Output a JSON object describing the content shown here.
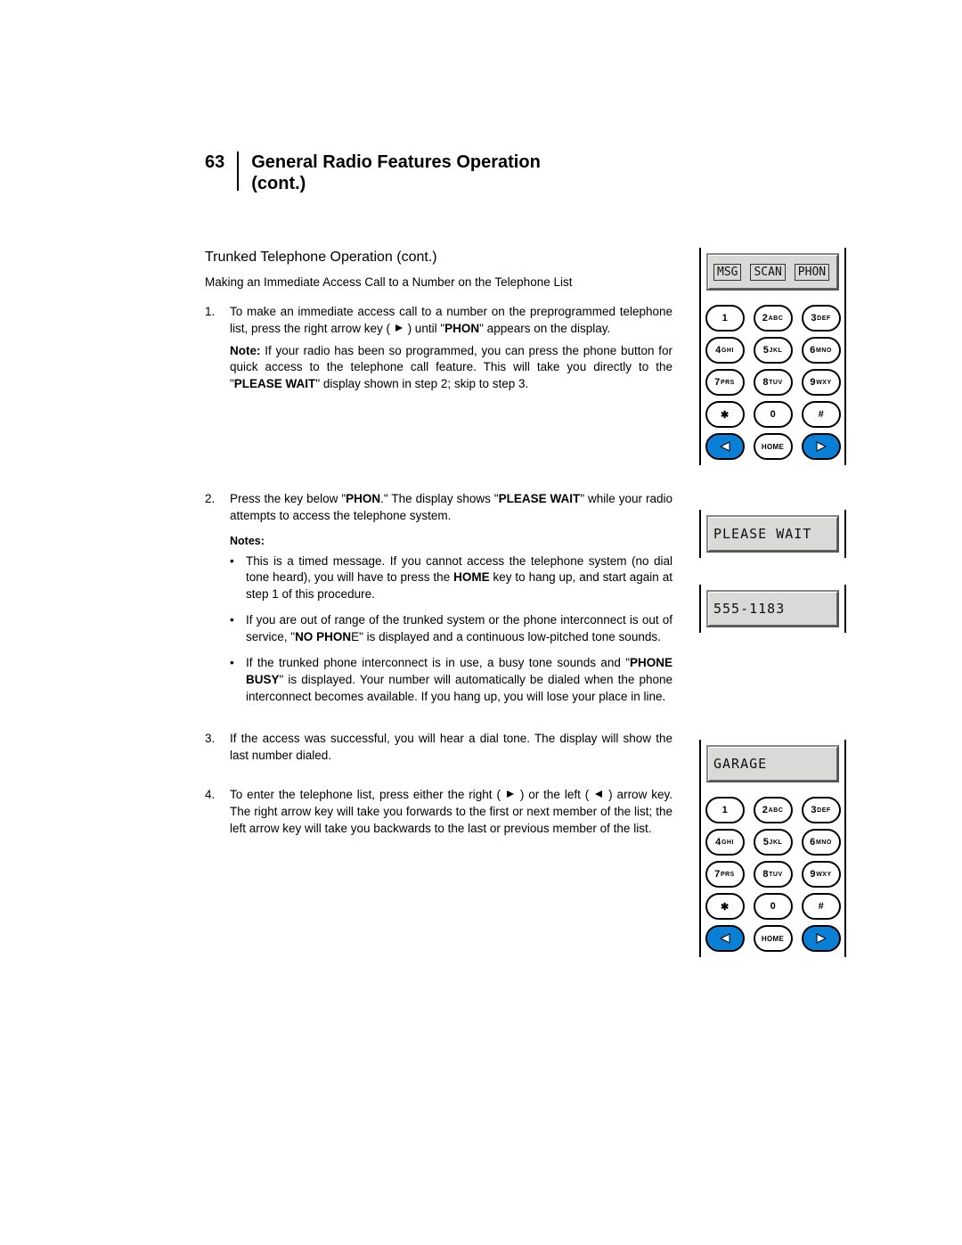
{
  "header": {
    "page_number": "63",
    "title_line1": "General Radio Features Operation",
    "title_line2": "(cont.)"
  },
  "subsection": "Trunked Telephone Operation (cont.)",
  "intro": "Making an Immediate Access Call to a Number on the Telephone List",
  "steps": {
    "s1": {
      "num": "1.",
      "text_before_arrow": "To make an immediate access call to a number on the preprogrammed telephone list, press the right arrow key ( ",
      "text_after_arrow": " ) until \"",
      "bold1": "PHON",
      "text_after_bold": "\" appears on the display.",
      "note_prefix": "Note:",
      "note_body_1": " If your radio has been so programmed, you can press the phone button for quick access to the telephone call feature. This will take you directly to the \"",
      "note_bold": "PLEASE WAIT",
      "note_body_2": "\" display shown in step 2; skip to step 3."
    },
    "s2": {
      "num": "2.",
      "text_1": "Press the key below \"",
      "bold1": "PHON",
      "text_2": ".\" The display shows \"",
      "bold2": "PLEASE WAIT",
      "text_3": "\" while your radio attempts to access the telephone system."
    },
    "notes_label": "Notes:",
    "notes": {
      "n1_a": "This is a timed message. If you cannot access the telephone system (no dial tone heard), you will have to press the ",
      "n1_bold": "HOME",
      "n1_b": " key to hang up, and start again at step 1 of this procedure.",
      "n2_a": "If you are out of range of the trunked system or the phone interconnect is out of service, \"",
      "n2_bold": "NO PHON",
      "n2_b": "E\" is displayed and a continuous low-pitched tone sounds.",
      "n3_a": "If the trunked phone interconnect is in use, a busy tone sounds and \"",
      "n3_bold": "PHONE BUSY",
      "n3_b": "\" is displayed. Your number will automatically be dialed when the phone interconnect becomes available. If you hang up, you will lose your place in line."
    },
    "s3": {
      "num": "3.",
      "text": "If the access was successful, you will hear a dial tone. The display will show the last number dialed."
    },
    "s4": {
      "num": "4.",
      "text_a": "To enter the telephone list, press either the right ( ",
      "text_b": " ) or the left ( ",
      "text_c": " ) arrow key. The right arrow key will take you forwards to the first or next member of the list; the left arrow key will take you backwards to the last or previous member of the list."
    }
  },
  "displays": {
    "d1_seg1": "MSG",
    "d1_seg2": "SCAN",
    "d1_seg3": "PHON",
    "d2": "PLEASE WAIT",
    "d3": "555-1183",
    "d4": "GARAGE"
  },
  "keypad": {
    "k1": "1",
    "k2": "2",
    "k2s": "ABC",
    "k3": "3",
    "k3s": "DEF",
    "k4": "4",
    "k4s": "GHI",
    "k5": "5",
    "k5s": "JKL",
    "k6": "6",
    "k6s": "MNO",
    "k7": "7",
    "k7s": "PRS",
    "k8": "8",
    "k8s": "TUV",
    "k9": "9",
    "k9s": "WXY",
    "kstar": "✱",
    "k0": "0",
    "khash": "#",
    "khome": "HOME"
  }
}
